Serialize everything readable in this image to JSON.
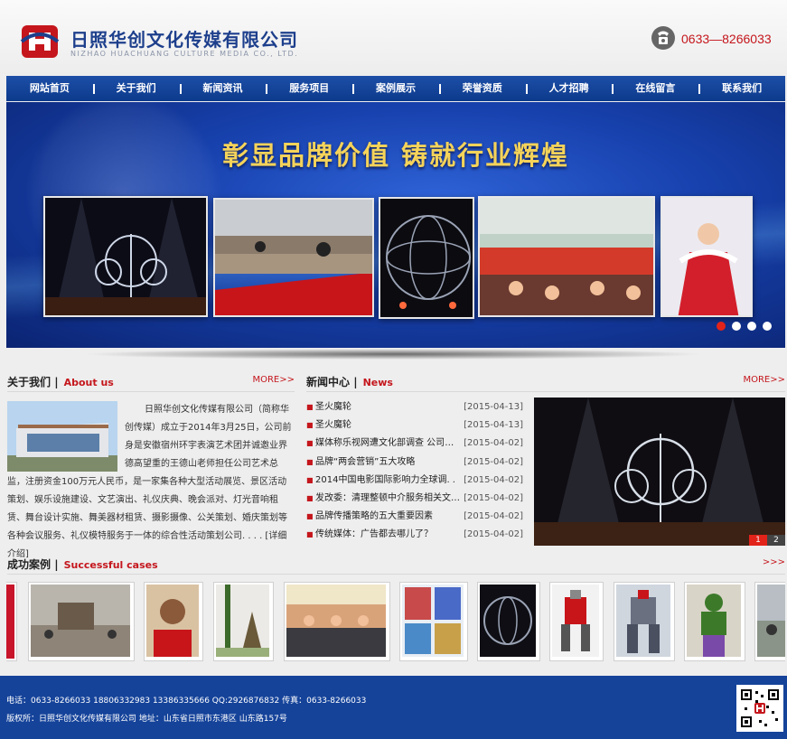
{
  "header": {
    "company_name": "日照华创文化传媒有限公司",
    "company_name_en": "NIZHAO HUACHUANG CULTURE MEDIA CO., LTD.",
    "phone": "0633—8266033"
  },
  "nav": {
    "items": [
      "网站首页",
      "关于我们",
      "新闻资讯",
      "服务项目",
      "案例展示",
      "荣誉资质",
      "人才招聘",
      "在线留言",
      "联系我们"
    ]
  },
  "banner": {
    "slogan": "彰显品牌价值  铸就行业辉煌",
    "slide_count": 4,
    "active_slide": 1
  },
  "about": {
    "title": "关于我们",
    "title_en": "About us",
    "more": "MORE>>",
    "text": "日照华创文化传媒有限公司（简称华创传媒）成立于2014年3月25日，公司前身是安徽宿州环宇表演艺术团并诚邀业界德高望重的王德山老师担任公司艺术总监，注册资金100万元人民币，是一家集各种大型活动展览、景区活动策划、娱乐设施建设、文艺演出、礼仪庆典、晚会派对、灯光音响租赁、舞台设计实施、舞美器材租赁、摄影摄像、公关策划、婚庆策划等各种会议服务、礼仪模特服务于一体的综合性活动策划公司. . . . [详细介绍]"
  },
  "news": {
    "title": "新闻中心",
    "title_en": "News",
    "more": "MORE>>",
    "items": [
      {
        "title": "圣火魔轮",
        "date": "[2015-04-13]"
      },
      {
        "title": "圣火魔轮",
        "date": "[2015-04-13]"
      },
      {
        "title": "媒体称乐视网遭文化部调查 公司今. .",
        "date": "[2015-04-02]"
      },
      {
        "title": "品牌“两会营销”五大攻略",
        "date": "[2015-04-02]"
      },
      {
        "title": "2014中国电影国际影响力全球调. .",
        "date": "[2015-04-02]"
      },
      {
        "title": "发改委：清理整顿中介服务相关文件. .",
        "date": "[2015-04-02]"
      },
      {
        "title": "品牌传播策略的五大重要因素",
        "date": "[2015-04-02]"
      },
      {
        "title": "传统媒体：广告都去哪儿了？",
        "date": "[2015-04-02]"
      }
    ],
    "photo_pages": [
      "1",
      "2"
    ],
    "photo_active_page": 1
  },
  "cases": {
    "title": "成功案例",
    "title_en": "Successful cases",
    "more": ">>>"
  },
  "footer": {
    "line1": "电话：0633-8266033  18806332983  13386335666  QQ:2926876832  传真：0633-8266033",
    "line2": "版权所：日照华创文化传媒有限公司  地址：山东省日照市东港区  山东路157号"
  },
  "colors": {
    "brand_blue": "#15439a",
    "accent_red": "#c4161c",
    "slogan_gold": "#f5d35a"
  }
}
